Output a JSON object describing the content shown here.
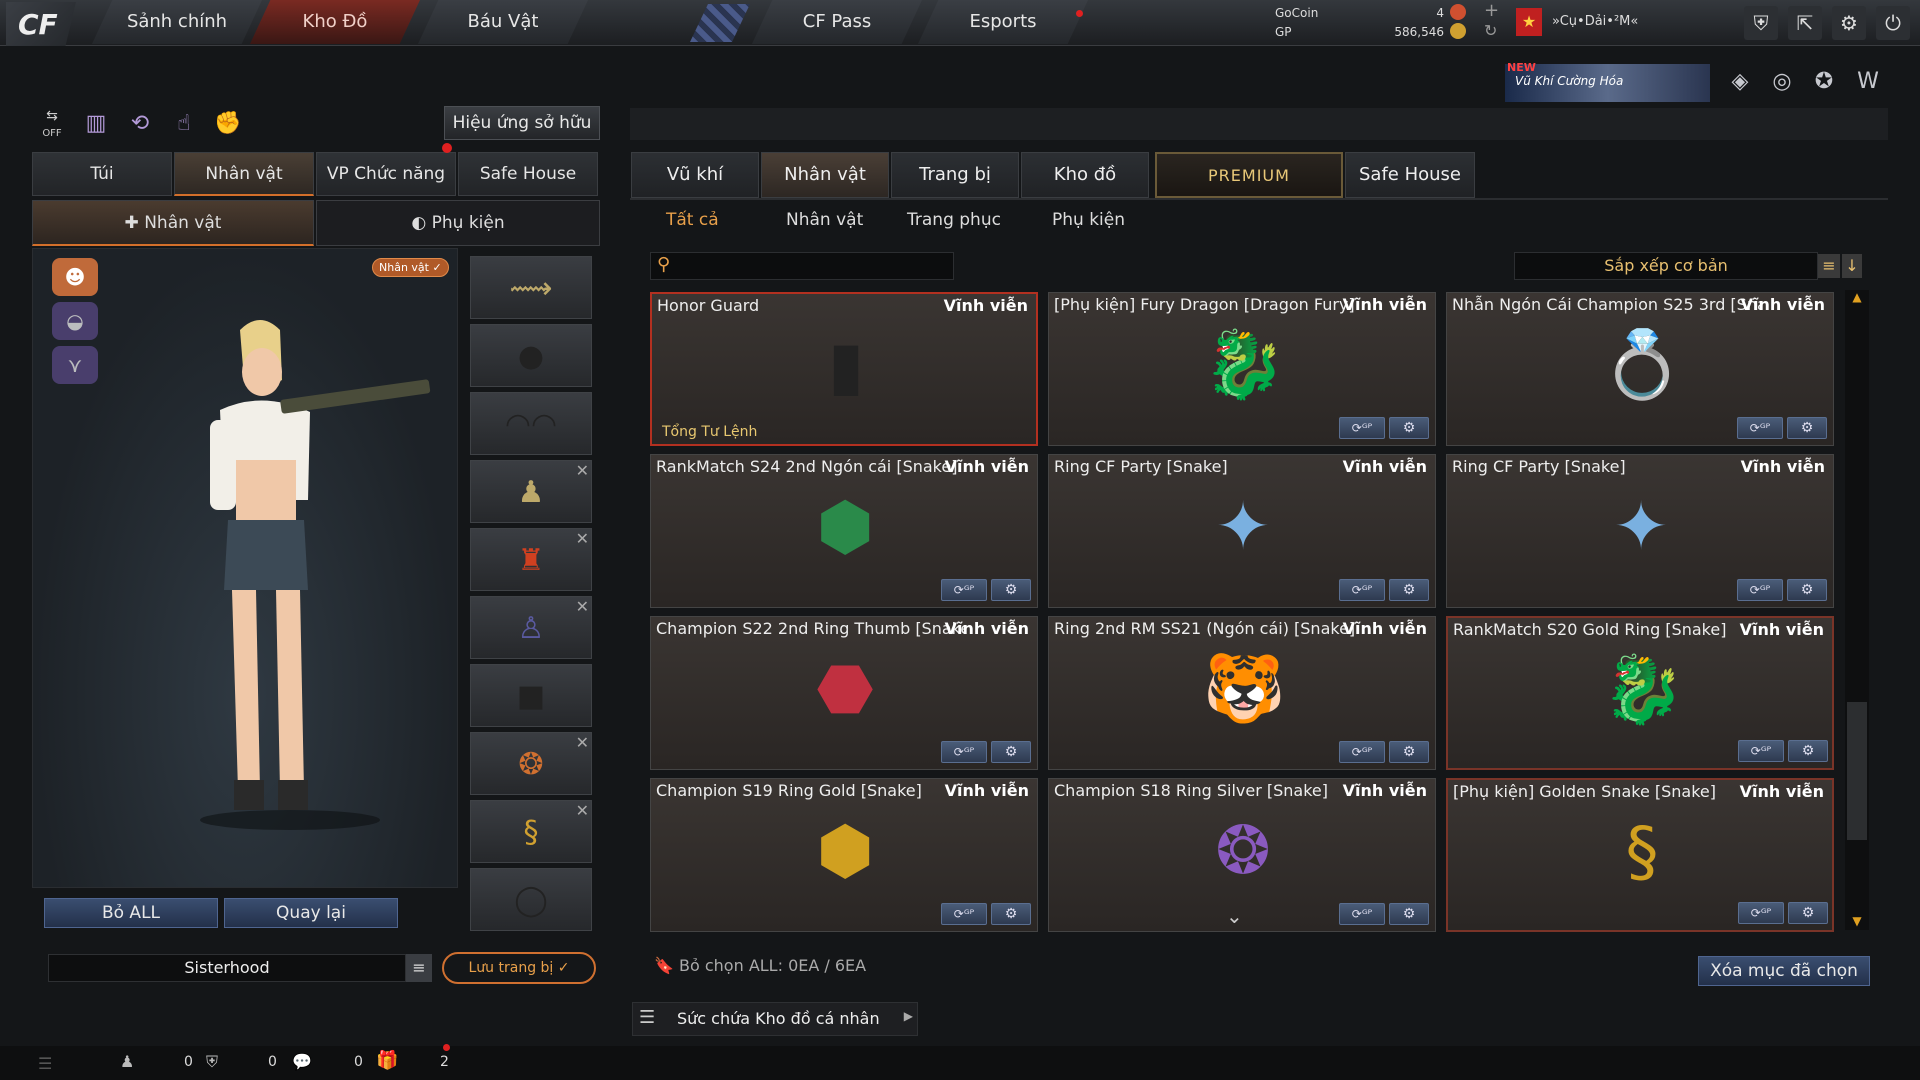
{
  "top_nav": {
    "logo": "CF",
    "tabs": [
      "Sảnh chính",
      "Kho Đồ",
      "Báu Vật"
    ],
    "tabs2": [
      "CF Pass",
      "Esports"
    ],
    "gocoin_label": "GoCoin",
    "gocoin_value": "4",
    "gp_label": "GP",
    "gp_value": "586,546",
    "username": "»Cụ•Dải•²M«",
    "icons": [
      "shield-icon",
      "exit-icon",
      "gear-icon",
      "power-icon"
    ]
  },
  "banner": {
    "badge": "NEW",
    "text": "Vũ Khí Cường Hóa"
  },
  "left": {
    "owned_effects_button": "Hiệu ứng sở hữu",
    "off_label": "OFF",
    "tabs": [
      "Túi",
      "Nhân vật",
      "VP Chức năng",
      "Safe House"
    ],
    "subtabs": [
      "Nhân vật",
      "Phụ kiện"
    ],
    "character_badge": "Nhân vật ✓",
    "remove_all": "Bỏ ALL",
    "back": "Quay lại",
    "preset_name": "Sisterhood",
    "save_button": "Lưu trang bị"
  },
  "right": {
    "tabs": [
      "Vũ khí",
      "Nhân vật",
      "Trang bị",
      "Kho đồ",
      "PREMIUM",
      "Safe House"
    ],
    "filters": [
      "Tất cả",
      "Nhân vật",
      "Trang phục",
      "Phụ kiện"
    ],
    "search_placeholder": "",
    "sort_label": "Sắp xếp cơ bản",
    "items": [
      {
        "name": "Honor Guard",
        "duration": "Vĩnh viễn",
        "tag": "Tổng Tư Lệnh"
      },
      {
        "name": "[Phụ kiện] Fury Dragon [Dragon Fury]",
        "duration": "Vĩnh viễn"
      },
      {
        "name": "Nhẫn Ngón Cái Champion S25 3rd [Snake]",
        "duration": "Vĩnh viễn"
      },
      {
        "name": "RankMatch S24 2nd Ngón cái [Snake]",
        "duration": "Vĩnh viễn"
      },
      {
        "name": "Ring CF Party [Snake]",
        "duration": "Vĩnh viễn"
      },
      {
        "name": "Ring CF Party [Snake]",
        "duration": "Vĩnh viễn"
      },
      {
        "name": "Champion S22 2nd Ring Thumb [Snake]",
        "duration": "Vĩnh viễn"
      },
      {
        "name": "Ring 2nd RM SS21 (Ngón cái) [Snake]",
        "duration": "Vĩnh viễn"
      },
      {
        "name": "RankMatch S20 Gold Ring [Snake]",
        "duration": "Vĩnh viễn"
      },
      {
        "name": "Champion S19 Ring Gold [Snake]",
        "duration": "Vĩnh viễn"
      },
      {
        "name": "Champion S18 Ring Silver [Snake]",
        "duration": "Vĩnh viễn"
      },
      {
        "name": "[Phụ kiện] Golden Snake [Snake]",
        "duration": "Vĩnh viễn"
      }
    ],
    "deselect_all": "Bỏ chọn ALL: 0EA / 6EA",
    "delete_selected": "Xóa mục đã chọn",
    "capacity": "Sức chứa Kho đồ cá nhân"
  },
  "bottom": {
    "counts": [
      "0",
      "0",
      "0",
      "2"
    ]
  }
}
